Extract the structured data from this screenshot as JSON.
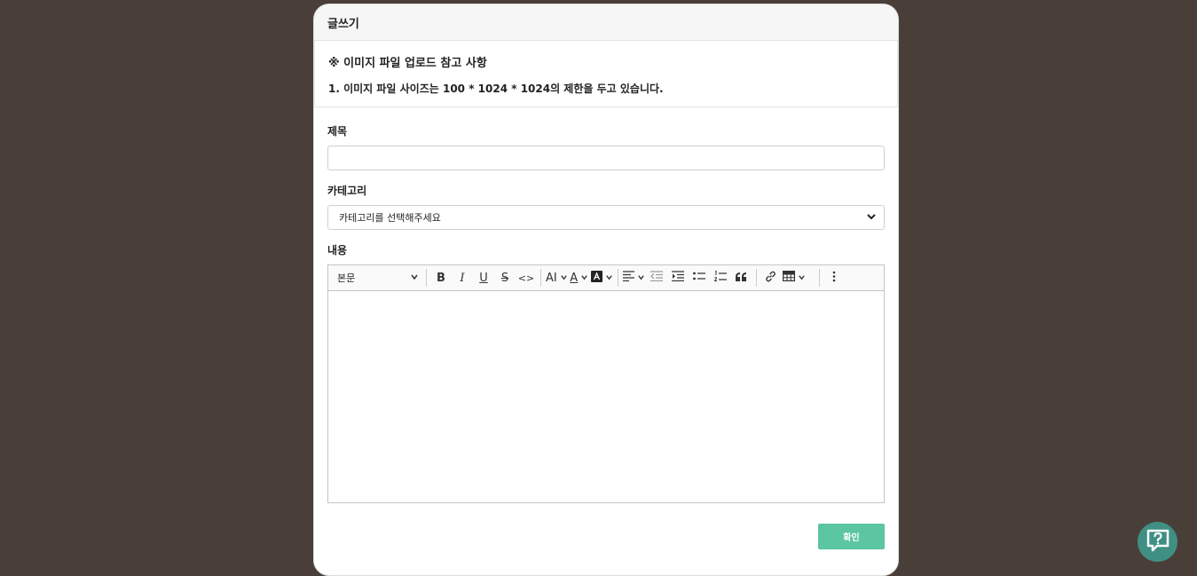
{
  "header": {
    "title": "글쓰기"
  },
  "notice": {
    "title": "※ 이미지 파일 업로드 참고 사항",
    "line1": "1. 이미지 파일 사이즈는 100 * 1024 * 1024의 제한을 두고 있습니다."
  },
  "form": {
    "title_label": "제목",
    "title_value": "",
    "category_label": "카테고리",
    "category_selected": "카테고리를 선택해주세요",
    "content_label": "내용"
  },
  "toolbar": {
    "heading": "본문",
    "bold": "B",
    "italic": "I",
    "underline": "U",
    "strike": "S",
    "code": "<>",
    "font_size": "AI",
    "font_color": "A"
  },
  "submit_label": "확인",
  "colors": {
    "accent": "#5bc6a1",
    "background": "#4a3f38",
    "help": "#3f8f84"
  },
  "icons": [
    "chevron-down-icon",
    "align-left-icon",
    "outdent-icon",
    "indent-icon",
    "bulleted-list-icon",
    "numbered-list-icon",
    "blockquote-icon",
    "link-icon",
    "table-icon",
    "more-vertical-icon",
    "help-icon"
  ]
}
